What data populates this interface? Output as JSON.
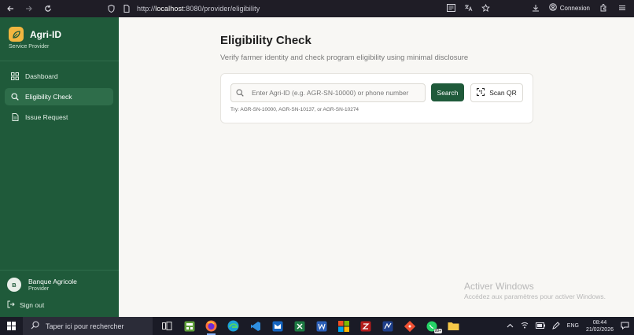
{
  "browser": {
    "url_prefix": "http://",
    "url_host": "localhost",
    "url_path": ":8080/provider/eligibility",
    "account_label": "Connexion"
  },
  "sidebar": {
    "brand_title": "Agri-ID",
    "brand_subtitle": "Service Provider",
    "items": [
      {
        "label": "Dashboard",
        "icon": "grid-icon",
        "active": false
      },
      {
        "label": "Eligibility Check",
        "icon": "search-icon",
        "active": true
      },
      {
        "label": "Issue Request",
        "icon": "document-icon",
        "active": false
      }
    ],
    "user": {
      "initial": "B",
      "name": "Banque Agricole",
      "role": "Provider"
    },
    "sign_out_label": "Sign out"
  },
  "main": {
    "title": "Eligibility Check",
    "subtitle": "Verify farmer identity and check program eligibility using minimal disclosure",
    "search": {
      "placeholder": "Enter Agri-ID (e.g. AGR-SN-10000) or phone number",
      "value": "",
      "button_label": "Search",
      "scan_label": "Scan QR",
      "hint": "Try: AGR-SN-10000, AGR-SN-10137, or AGR-SN-10274"
    }
  },
  "watermark": {
    "line1": "Activer Windows",
    "line2": "Accédez aux paramètres pour activer Windows."
  },
  "taskbar": {
    "search_placeholder": "Taper ici pour rechercher",
    "notification_badge": "99+",
    "language": "ENG",
    "time": "08:44",
    "date": "21/02/2026"
  },
  "colors": {
    "sidebar_bg": "#1f5a3a",
    "accent": "#1f5a3a",
    "brand_logo": "#f2b640",
    "page_bg": "#f8f7f4"
  }
}
